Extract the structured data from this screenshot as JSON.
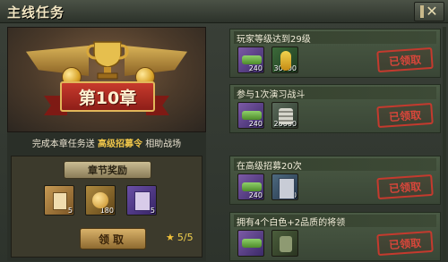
{
  "window": {
    "title": "主线任务"
  },
  "chapter": {
    "banner_label": "第10章",
    "desc_prefix": "完成本章任务送",
    "desc_highlight": "高级招募令",
    "desc_suffix": "相助战场",
    "reward_header": "章节奖励",
    "rewards": [
      {
        "icon": "scroll-icon",
        "qty": "5"
      },
      {
        "icon": "medal-icon",
        "qty": "180"
      },
      {
        "icon": "book-icon",
        "qty": "5"
      }
    ],
    "claim_label": "领取",
    "progress": "5/5"
  },
  "tasks": [
    {
      "name": "玩家等级达到29级",
      "rewards": [
        {
          "icon": "tank-icon",
          "qty": "240"
        },
        {
          "icon": "corn-icon",
          "qty": "30000"
        }
      ],
      "status": "已领取"
    },
    {
      "name": "参与1次演习战斗",
      "rewards": [
        {
          "icon": "tank-icon",
          "qty": "240"
        },
        {
          "icon": "silver-icon",
          "qty": "20000"
        }
      ],
      "status": "已领取"
    },
    {
      "name": "在高级招募20次",
      "rewards": [
        {
          "icon": "tank-icon",
          "qty": "240"
        },
        {
          "icon": "manual-icon",
          "qty": "20"
        }
      ],
      "status": "已领取"
    },
    {
      "name": "拥有4个白色+2品质的将领",
      "rewards": [
        {
          "icon": "tank-icon",
          "qty": ""
        },
        {
          "icon": "horse-icon",
          "qty": ""
        }
      ],
      "status": "已领取"
    }
  ],
  "colors": {
    "highlight": "#f0c64a",
    "stamp": "#c43a2e",
    "ribbon": "#c73a2c"
  }
}
